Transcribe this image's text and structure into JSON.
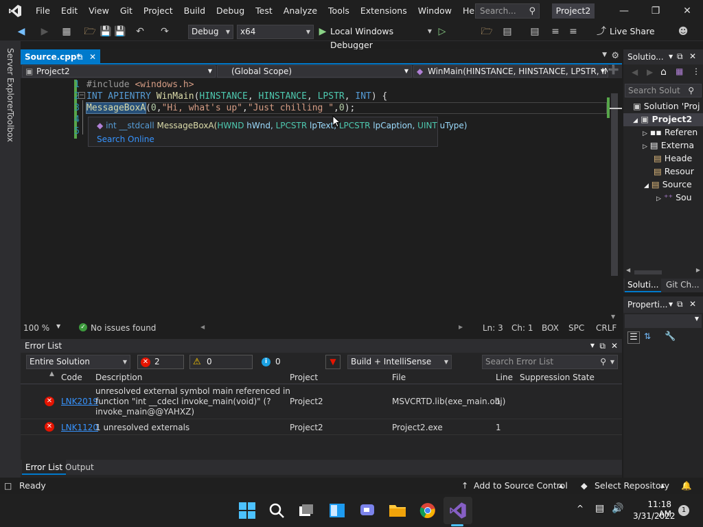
{
  "menu": {
    "items": [
      "File",
      "Edit",
      "View",
      "Git",
      "Project",
      "Build",
      "Debug",
      "Test",
      "Analyze",
      "Tools",
      "Extensions",
      "Window",
      "Help"
    ],
    "search_placeholder": "Search...",
    "solution_name": "Project2"
  },
  "toolbar": {
    "config": "Debug",
    "platform": "x64",
    "run_label": "Local Windows Debugger",
    "live_share": "Live Share"
  },
  "left_strip": {
    "server_explorer": "Server Explorer",
    "toolbox": "Toolbox"
  },
  "document": {
    "tab_label": "Source.cpp*",
    "nav_project": "Project2",
    "nav_scope": "(Global Scope)",
    "nav_function": "WinMain(HINSTANCE, HINSTANCE, LPSTR, INT"
  },
  "code": {
    "line_numbers": [
      "1",
      "2",
      "3",
      "4",
      "5"
    ],
    "line1": {
      "pre": "#include ",
      "inc": "<windows.h>"
    },
    "line2": {
      "kw": "INT",
      "kw2": " APIENTRY ",
      "fn": "WinMain",
      "p1": "(",
      "t1": "HINSTANCE",
      "c1": ", ",
      "t2": "HINSTANCE",
      "c2": ", ",
      "t3": "LPSTR",
      "c3": ", ",
      "t4": "INT",
      "end": ") {"
    },
    "line3": {
      "fn": "MessageBoxA",
      "open": "(",
      "n0": "0",
      "comma1": ",",
      "s1": "\"Hi, what's up\"",
      "comma2": ",",
      "s2": "\"Just chilling \"",
      "comma3": ",",
      "n1": "0",
      "end": ");"
    }
  },
  "tooltip": {
    "kw": "int __stdcall",
    "fn": " MessageBoxA(",
    "p1t": "HWND",
    "p1n": " hWnd, ",
    "p2t": "LPCSTR",
    "p2n": " lpText, ",
    "p3t": "LPCSTR",
    "p3n": " lpCaption, ",
    "p4t": "UINT",
    "p4n": " uType)",
    "search_online": "Search Online"
  },
  "editor_status": {
    "zoom": "100 %",
    "issues": "No issues found",
    "ln": "Ln: 3",
    "ch": "Ch: 1",
    "mode": "BOX",
    "ws": "SPC",
    "eol": "CRLF"
  },
  "error_list": {
    "title": "Error List",
    "scope": "Entire Solution",
    "errors": "2 Errors",
    "warnings": "0 Warnings",
    "messages": "0 Messages",
    "build_filter": "Build + IntelliSense",
    "search_placeholder": "Search Error List",
    "columns": [
      "Code",
      "Description",
      "Project",
      "File",
      "Line",
      "Suppression State"
    ],
    "rows": [
      {
        "code": "LNK2019",
        "desc1": "unresolved external symbol main referenced in",
        "desc2": "function \"int __cdecl invoke_main(void)\" (?",
        "desc3": "invoke_main@@YAHXZ)",
        "project": "Project2",
        "file": "MSVCRTD.lib(exe_main.obj)",
        "line": "1"
      },
      {
        "code": "LNK1120",
        "desc1": "1 unresolved externals",
        "project": "Project2",
        "file": "Project2.exe",
        "line": "1"
      }
    ],
    "tabs": [
      "Error List",
      "Output"
    ]
  },
  "solution_explorer": {
    "title": "Solutio...",
    "search_placeholder": "Search Solut",
    "items": [
      "Solution 'Proj",
      "Project2",
      "Referen",
      "Externa",
      "Heade",
      "Resour",
      "Source",
      "Sou"
    ],
    "tabs": [
      "Soluti...",
      "Git Ch..."
    ]
  },
  "properties": {
    "title": "Properti..."
  },
  "status_bar": {
    "ready": "Ready",
    "add_source": "Add to Source Control",
    "select_repo": "Select Repository"
  },
  "taskbar": {
    "time": "11:18 AM",
    "date": "3/31/2022",
    "notification_count": "1"
  },
  "colors": {
    "accent": "#007acc",
    "error": "#e51400",
    "vs_purple": "#865fc5"
  }
}
